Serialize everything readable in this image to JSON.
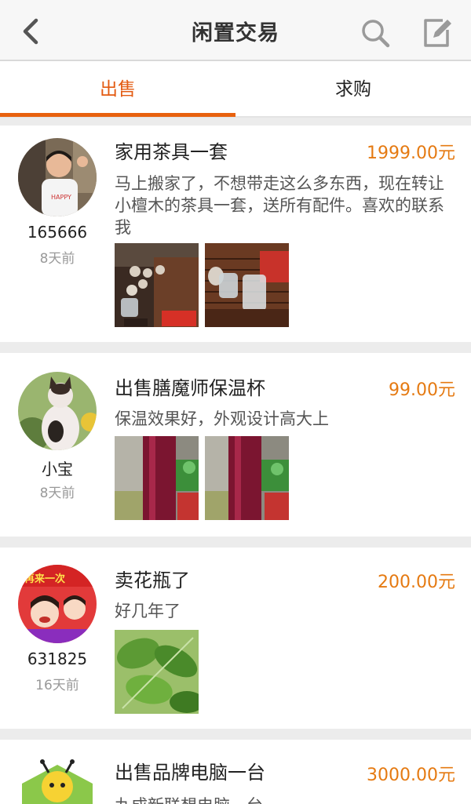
{
  "header": {
    "title": "闲置交易"
  },
  "tabs": [
    {
      "label": "出售"
    },
    {
      "label": "求购"
    }
  ],
  "posts": [
    {
      "user": "165666",
      "time": "8天前",
      "title": "家用茶具一套",
      "price": "1999.00元",
      "desc": "马上搬家了，不想带走这么多东西，现在转让小檀木的茶具一套，送所有配件。喜欢的联系我"
    },
    {
      "user": "小宝",
      "time": "8天前",
      "title": "出售膳魔师保温杯",
      "price": "99.00元",
      "desc": "保温效果好，外观设计高大上"
    },
    {
      "user": "631825",
      "time": "16天前",
      "title": "卖花瓶了",
      "price": "200.00元",
      "desc": "好几年了"
    },
    {
      "user": "",
      "time": "",
      "title": "出售品牌电脑一台",
      "price": "3000.00元",
      "desc": "九成新联想电脑一台"
    }
  ],
  "colors": {
    "accent": "#e8610e",
    "price": "#e57a12"
  }
}
